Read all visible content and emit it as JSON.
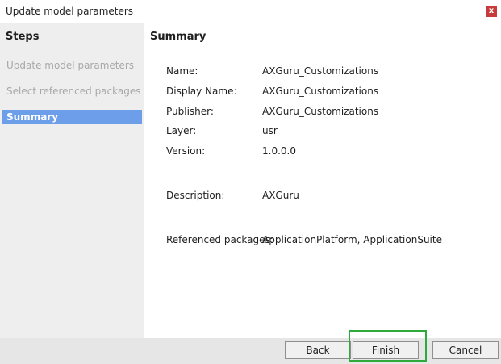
{
  "window": {
    "title": "Update model parameters",
    "close_label": "x"
  },
  "steps": {
    "heading": "Steps",
    "items": [
      {
        "label": "Update model parameters"
      },
      {
        "label": "Select referenced packages"
      },
      {
        "label": "Summary"
      }
    ]
  },
  "summary": {
    "heading": "Summary",
    "fields": [
      {
        "label": "Name:",
        "value": "AXGuru_Customizations"
      },
      {
        "label": "Display Name:",
        "value": "AXGuru_Customizations"
      },
      {
        "label": "Publisher:",
        "value": "AXGuru_Customizations"
      },
      {
        "label": "Layer:",
        "value": "usr"
      },
      {
        "label": "Version:",
        "value": "1.0.0.0"
      },
      {
        "label": "Description:",
        "value": "AXGuru"
      },
      {
        "label": "Referenced packages:",
        "value": "ApplicationPlatform, ApplicationSuite"
      }
    ]
  },
  "buttons": {
    "back": "Back",
    "finish": "Finish",
    "cancel": "Cancel"
  },
  "colors": {
    "active_step": "#6d9eea",
    "close_button": "#c73b3b",
    "highlight": "#2eaa3d"
  }
}
